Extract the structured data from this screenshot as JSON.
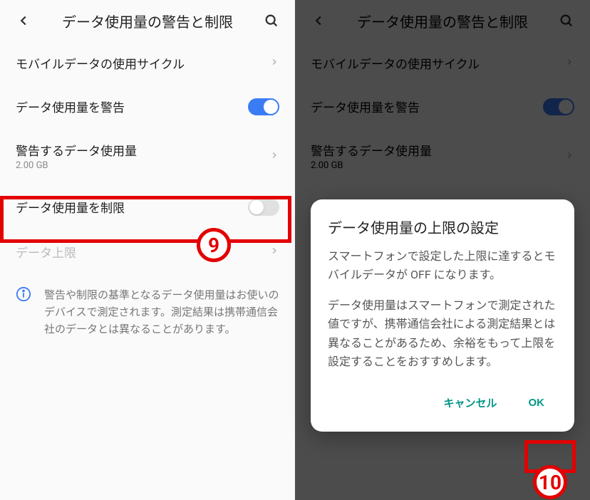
{
  "left": {
    "header_title": "データ使用量の警告と制限",
    "rows": {
      "cycle": {
        "label": "モバイルデータの使用サイクル"
      },
      "warn": {
        "label": "データ使用量を警告"
      },
      "warn_amount": {
        "label": "警告するデータ使用量",
        "sub": "2.00 GB"
      },
      "limit": {
        "label": "データ使用量を制限"
      },
      "limit_amount": {
        "label": "データ上限"
      }
    },
    "info": "警告や制限の基準となるデータ使用量はお使いのデバイスで測定されます。測定結果は携帯通信会社のデータとは異なることがあります。",
    "callout": "9"
  },
  "right": {
    "header_title": "データ使用量の警告と制限",
    "rows": {
      "cycle": {
        "label": "モバイルデータの使用サイクル"
      },
      "warn": {
        "label": "データ使用量を警告"
      },
      "warn_amount": {
        "label": "警告するデータ使用量",
        "sub": "2.00 GB"
      }
    },
    "dialog": {
      "title": "データ使用量の上限の設定",
      "p1": "スマートフォンで設定した上限に達するとモバイルデータが OFF になります。",
      "p2": "データ使用量はスマートフォンで測定された値ですが、携帯通信会社による測定結果とは異なることがあるため、余裕をもって上限を設定することをおすすめします。",
      "cancel": "キャンセル",
      "ok": "OK"
    },
    "callout": "10"
  }
}
